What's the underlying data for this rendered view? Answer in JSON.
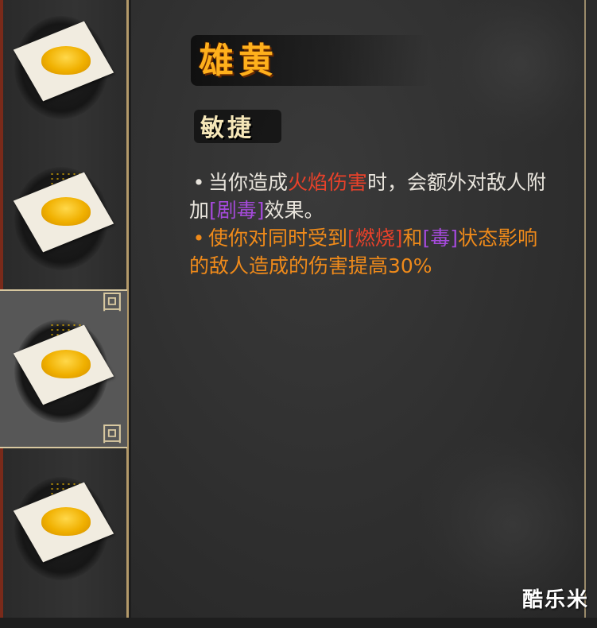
{
  "item": {
    "name": "雄黄",
    "category": "敏捷"
  },
  "description": {
    "line1": {
      "bullet": "•",
      "text_a": "当你造成",
      "fire_damage": "火焰伤害",
      "text_b": "时，会额外对敌人附加",
      "poison_tag": "[剧毒]",
      "text_c": "效果。"
    },
    "line2": {
      "bullet": "•",
      "text_a": "使你对同时受到",
      "burn_tag": "[燃烧]",
      "text_b": "和",
      "poison_tag": "[毒]",
      "text_c": "状态影响的敌人造成的伤害提高30%"
    }
  },
  "inventory": {
    "slots": [
      {
        "icon": "realgar-powder-icon",
        "selected": false
      },
      {
        "icon": "realgar-powder-icon",
        "selected": false
      },
      {
        "icon": "realgar-powder-icon",
        "selected": true
      },
      {
        "icon": "realgar-powder-icon",
        "selected": false
      }
    ]
  },
  "watermark": "酷乐米",
  "colors": {
    "title": "#ffb01c",
    "fire": "#e8412a",
    "poison": "#a54adb",
    "highlight": "#ef8a1a",
    "frame": "#d8c8a0"
  }
}
